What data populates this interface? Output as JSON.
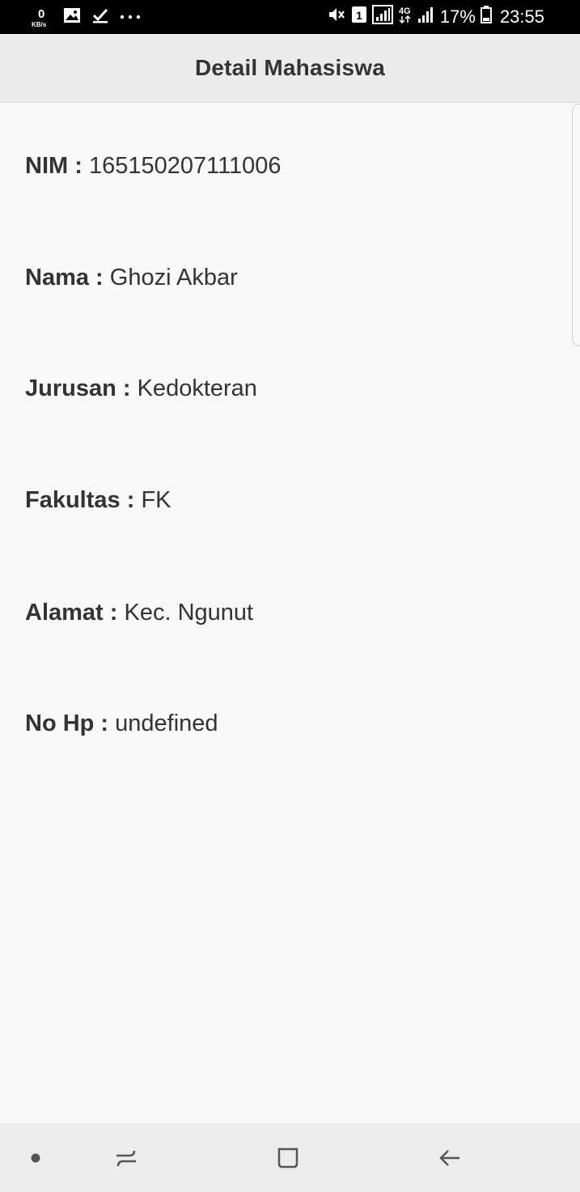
{
  "status_bar": {
    "net_speed_value": "0",
    "net_speed_unit": "KB/s",
    "sim_badge": "1",
    "network_type": "4G",
    "battery": "17%",
    "time": "23:55",
    "icons": [
      "gallery-icon",
      "checkmark-icon",
      "more-dots-icon",
      "mute-icon",
      "sim-icon",
      "signal-icon",
      "battery-icon"
    ]
  },
  "header": {
    "title": "Detail Mahasiswa"
  },
  "details": [
    {
      "label": "NIM :",
      "value": "165150207111006"
    },
    {
      "label": "Nama :",
      "value": "Ghozi Akbar"
    },
    {
      "label": "Jurusan :",
      "value": "Kedokteran"
    },
    {
      "label": "Fakultas :",
      "value": "FK"
    },
    {
      "label": "Alamat :",
      "value": "Kec. Ngunut"
    },
    {
      "label": "No Hp :",
      "value": "undefined"
    }
  ],
  "nav_bar": {
    "icons": [
      "dot-icon",
      "recents-icon",
      "home-icon",
      "back-icon"
    ]
  }
}
